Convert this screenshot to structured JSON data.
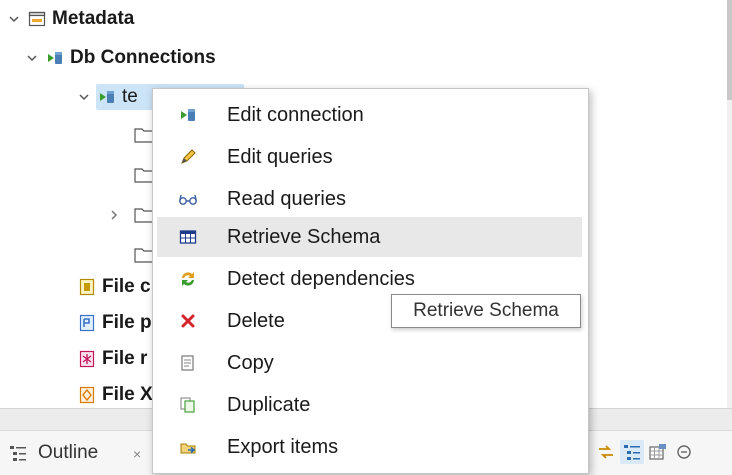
{
  "tree": {
    "metadata_label": "Metadata",
    "db_connections_label": "Db Connections",
    "selected_connection_label": "te",
    "file_rows": [
      {
        "label": "File c"
      },
      {
        "label": "File p"
      },
      {
        "label": "File r"
      },
      {
        "label": "File X"
      }
    ]
  },
  "context_menu": {
    "items": [
      {
        "label": "Edit connection",
        "icon": "db-connection-icon"
      },
      {
        "label": "Edit queries",
        "icon": "pencil-icon"
      },
      {
        "label": "Read queries",
        "icon": "glasses-icon"
      },
      {
        "label": "Retrieve Schema",
        "icon": "table-icon"
      },
      {
        "label": "Detect dependencies",
        "icon": "refresh-arrows-icon"
      },
      {
        "label": "Delete",
        "icon": "red-x-icon"
      },
      {
        "label": "Copy",
        "icon": "copy-icon"
      },
      {
        "label": "Duplicate",
        "icon": "duplicate-icon"
      },
      {
        "label": "Export items",
        "icon": "export-icon"
      }
    ],
    "hovered_index": 3
  },
  "tooltip": {
    "text": "Retrieve Schema"
  },
  "outline": {
    "label": "Outline",
    "close_glyph": "×"
  },
  "colors": {
    "selection": "#cce4f7",
    "menu_hover": "#e8e8e8",
    "delete_red": "#d4232a",
    "db_green": "#3a9b2e"
  }
}
